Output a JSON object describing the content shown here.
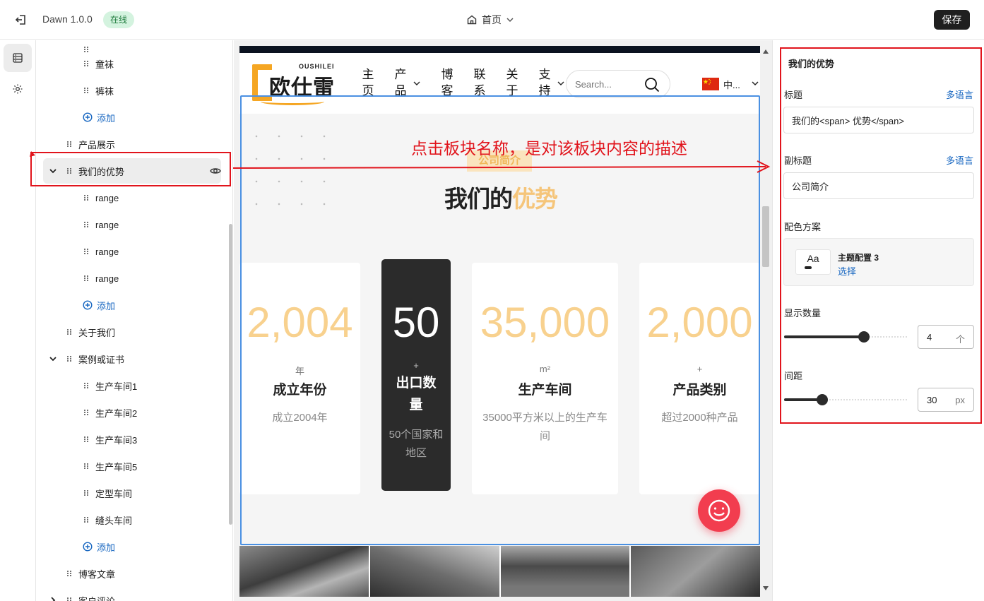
{
  "topbar": {
    "app_title": "Dawn 1.0.0",
    "status": "在线",
    "page_select": "首页",
    "save_label": "保存"
  },
  "tree": {
    "items": [
      {
        "label": "童袜"
      },
      {
        "label": "裤袜"
      },
      {
        "label": "添加"
      },
      {
        "label": "产品展示"
      },
      {
        "label": "我们的优势"
      },
      {
        "label": "range"
      },
      {
        "label": "range"
      },
      {
        "label": "range"
      },
      {
        "label": "range"
      },
      {
        "label": "添加"
      },
      {
        "label": "关于我们"
      },
      {
        "label": "案例或证书"
      },
      {
        "label": "生产车间1"
      },
      {
        "label": "生产车间2"
      },
      {
        "label": "生产车间3"
      },
      {
        "label": "生产车间5"
      },
      {
        "label": "定型车间"
      },
      {
        "label": "缝头车间"
      },
      {
        "label": "添加"
      },
      {
        "label": "博客文章"
      },
      {
        "label": "客户评论"
      }
    ]
  },
  "site": {
    "logo_en": "OUSHILEI",
    "logo_cn": "欧仕雷",
    "nav": [
      "主页",
      "产品",
      "博客",
      "联系",
      "关于",
      "支持"
    ],
    "search_placeholder": "Search...",
    "lang": "中..."
  },
  "section": {
    "badge": "公司简介",
    "title_main": "我们的",
    "title_highlight": "优势",
    "cards": [
      {
        "num": "2,004",
        "unit": "年",
        "title": "成立年份",
        "desc": "成立2004年"
      },
      {
        "num": "50",
        "unit": "+",
        "title": "出口数量",
        "desc": "50个国家和地区"
      },
      {
        "num": "35,000",
        "unit": "m²",
        "title": "生产车间",
        "desc": "35000平方米以上的生产车间"
      },
      {
        "num": "2,000",
        "unit": "+",
        "title": "产品类别",
        "desc": "超过2000种产品"
      }
    ]
  },
  "settings": {
    "panel_title": "我们的优势",
    "title_label": "标题",
    "multi_lang": "多语言",
    "title_value": "我们的<span> 优势</span>",
    "subtitle_label": "副标题",
    "subtitle_value": "公司简介",
    "scheme_label": "配色方案",
    "scheme_aa": "Aa",
    "scheme_name": "主题配置 3",
    "scheme_choose": "选择",
    "count_label": "显示数量",
    "count_value": "4",
    "count_unit": "个",
    "count_fraction": 0.65,
    "spacing_label": "间距",
    "spacing_value": "30",
    "spacing_unit": "px",
    "spacing_fraction": 0.31
  },
  "annotation": {
    "text": "点击板块名称，是对该板块内容的描述",
    "color": "#e1141c"
  }
}
